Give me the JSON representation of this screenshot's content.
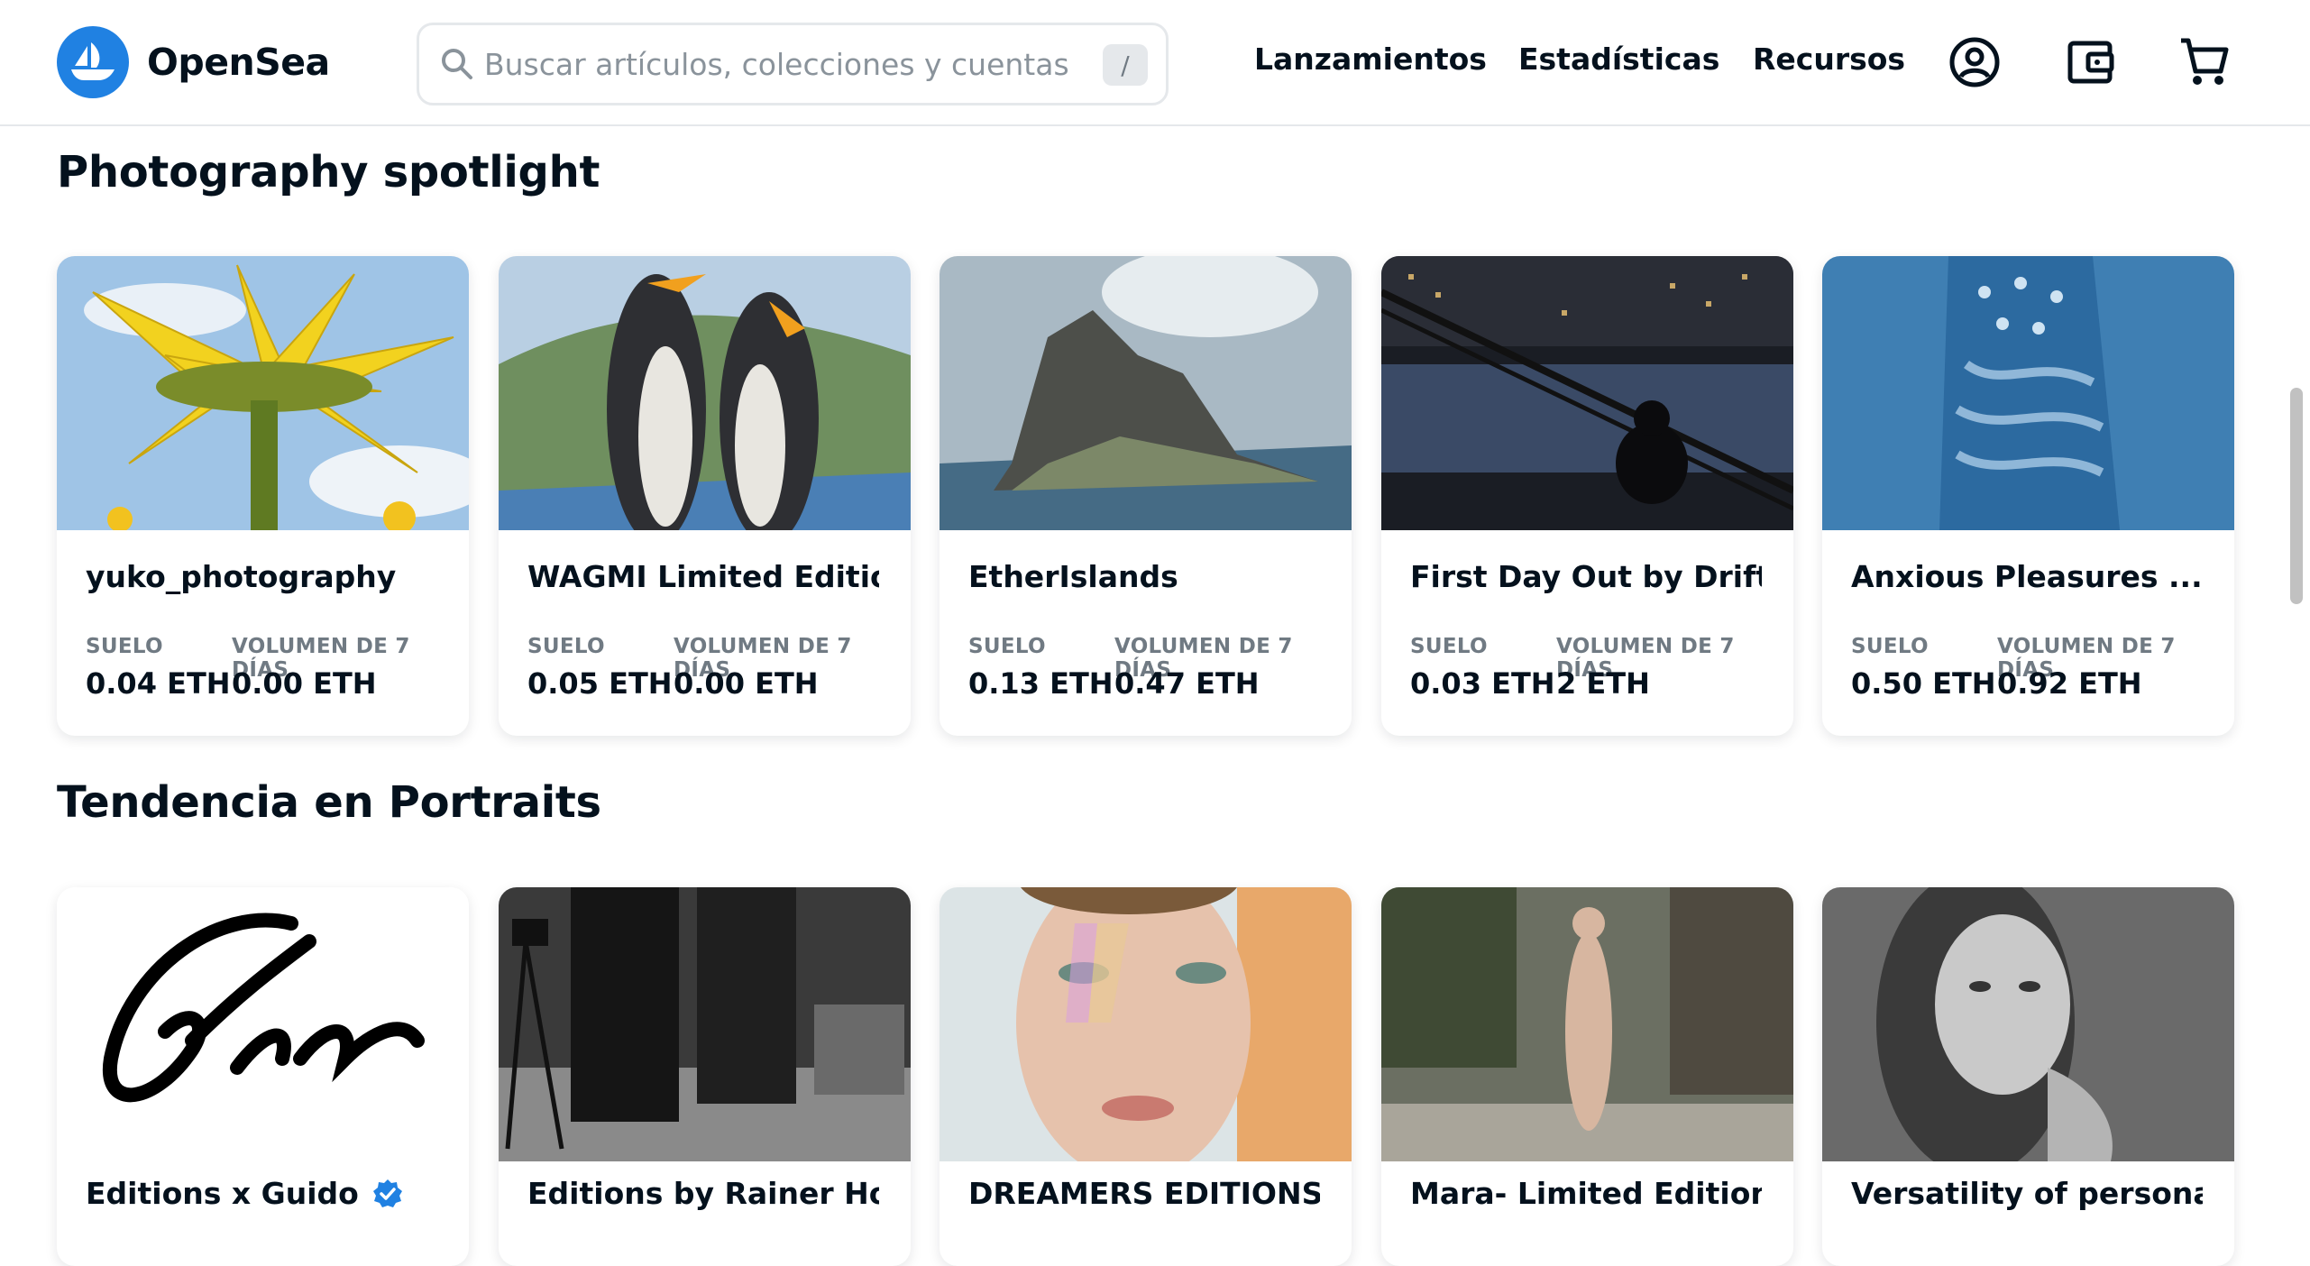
{
  "header": {
    "logo_text": "OpenSea",
    "search_placeholder": "Buscar artículos, colecciones y cuentas",
    "search_shortcut": "/",
    "nav": [
      "Lanzamientos",
      "Estadísticas",
      "Recursos"
    ]
  },
  "sections": [
    {
      "title": "Photography spotlight",
      "cards": [
        {
          "name": "yuko_photography",
          "verified": false,
          "floor_label": "SUELO",
          "floor": "0.04 ETH",
          "volume_label": "VOLUMEN DE 7 DÍAS",
          "volume": "0.00 ETH"
        },
        {
          "name": "WAGMI Limited Editions",
          "verified": false,
          "floor_label": "SUELO",
          "floor": "0.05 ETH",
          "volume_label": "VOLUMEN DE 7 DÍAS",
          "volume": "0.00 ETH"
        },
        {
          "name": "EtherIslands",
          "verified": false,
          "floor_label": "SUELO",
          "floor": "0.13 ETH",
          "volume_label": "VOLUMEN DE 7 DÍAS",
          "volume": "0.47 ETH"
        },
        {
          "name": "First Day Out by Drifter...",
          "verified": false,
          "floor_label": "SUELO",
          "floor": "0.03 ETH",
          "volume_label": "VOLUMEN DE 7 DÍAS",
          "volume": "2 ETH"
        },
        {
          "name": "Anxious Pleasures ...",
          "verified": true,
          "floor_label": "SUELO",
          "floor": "0.50 ETH",
          "volume_label": "VOLUMEN DE 7 DÍAS",
          "volume": "0.92 ETH"
        }
      ]
    },
    {
      "title": "Tendencia en Portraits",
      "cards": [
        {
          "name": "Editions x Guido",
          "verified": true
        },
        {
          "name": "Editions by Rainer Hos...",
          "verified": false
        },
        {
          "name": "DREAMERS EDITIONS BY...",
          "verified": false
        },
        {
          "name": "Mara- Limited Edition",
          "verified": false
        },
        {
          "name": "Versatility of personali...",
          "verified": false
        }
      ]
    }
  ],
  "colors": {
    "brand": "#2081e2",
    "text": "#04111d",
    "muted": "#707a83",
    "verified": "#2081e2"
  }
}
